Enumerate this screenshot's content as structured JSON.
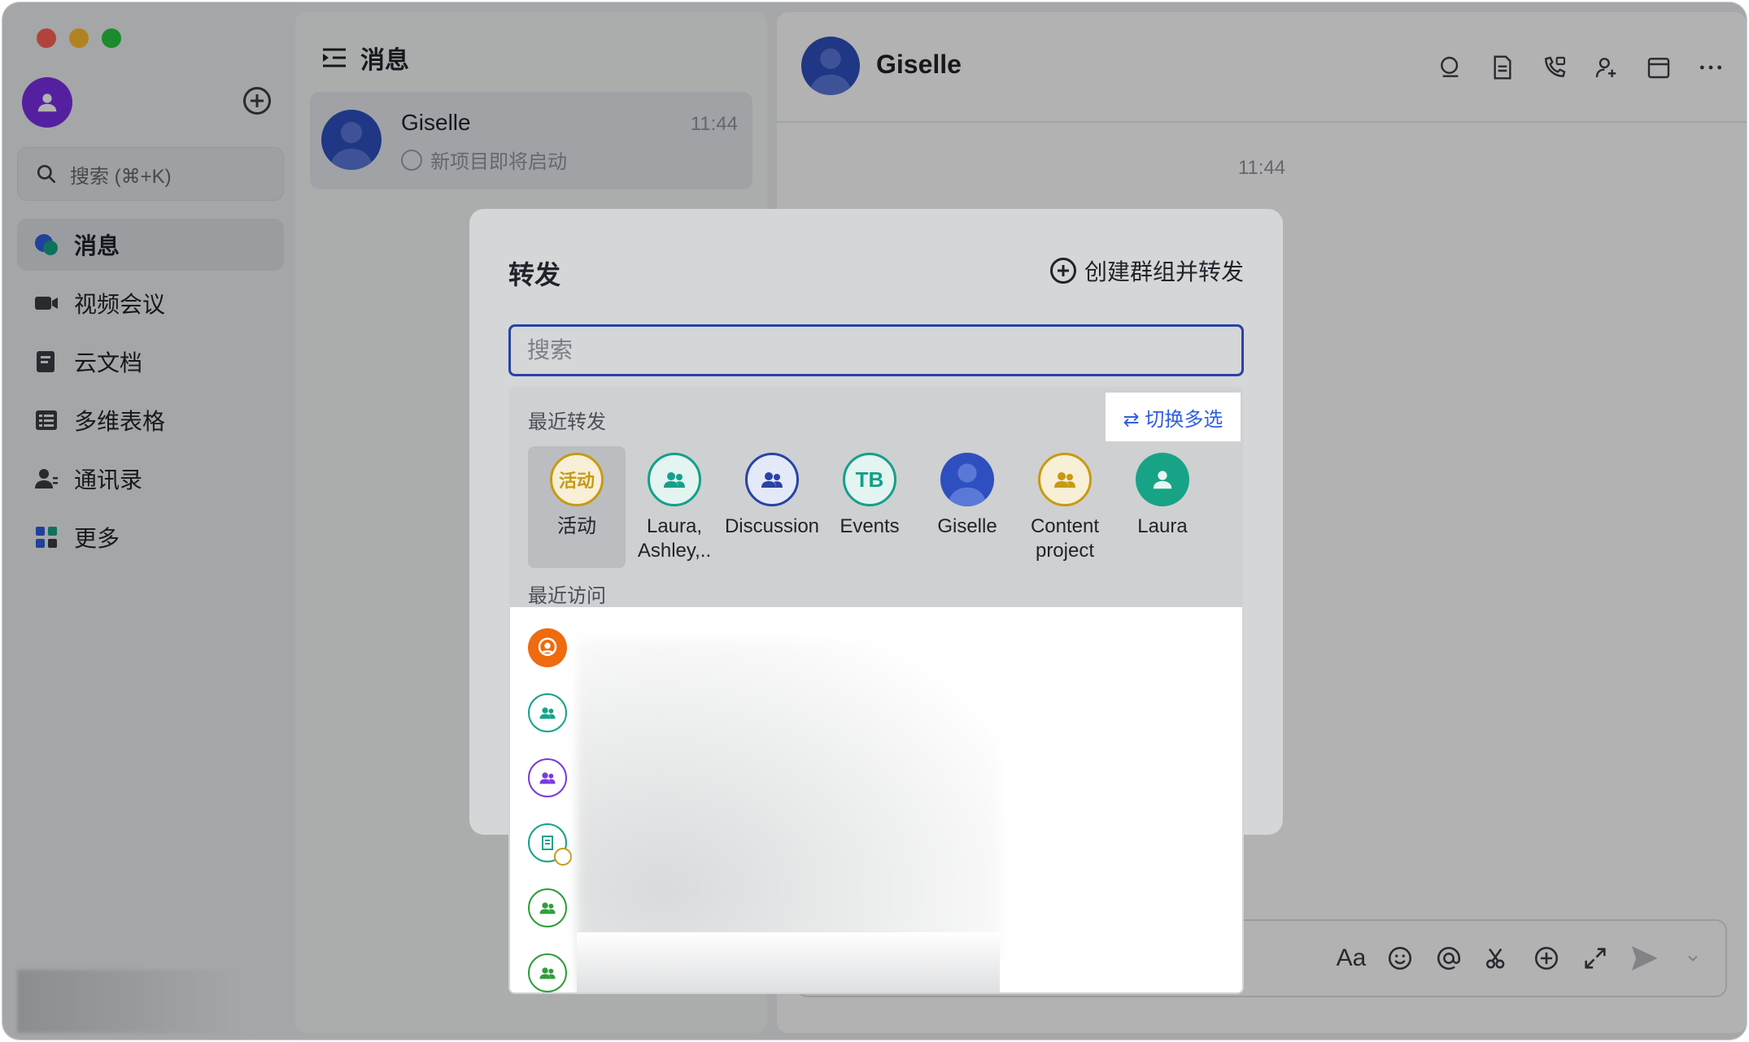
{
  "sidebar": {
    "search_placeholder": "搜索 (⌘+K)",
    "items": [
      {
        "label": "消息",
        "icon": "messages-icon"
      },
      {
        "label": "视频会议",
        "icon": "video-icon"
      },
      {
        "label": "云文档",
        "icon": "docs-icon"
      },
      {
        "label": "多维表格",
        "icon": "base-icon"
      },
      {
        "label": "通讯录",
        "icon": "contacts-icon"
      },
      {
        "label": "更多",
        "icon": "more-apps-icon"
      }
    ]
  },
  "chatlist": {
    "title": "消息",
    "chats": [
      {
        "name": "Giselle",
        "time": "11:44",
        "preview": "新项目即将启动"
      }
    ]
  },
  "chat": {
    "name": "Giselle",
    "message_time": "11:44",
    "composer_font_label": "Aa"
  },
  "dialog": {
    "title": "转发",
    "create_group_label": "创建群组并转发",
    "search_placeholder": "搜索",
    "recent_forward_label": "最近转发",
    "switch_multi_label": "⇄ 切换多选",
    "recent_visit_label": "最近访问",
    "recent": [
      {
        "name": "活动",
        "avatar_text": "活动",
        "color": "#c79a14",
        "style": "ring"
      },
      {
        "name": "Laura, Ashley,..",
        "avatar_text": "",
        "color": "#13a08a",
        "style": "ring"
      },
      {
        "name": "Discussion",
        "avatar_text": "",
        "color": "#2743a6",
        "style": "ring"
      },
      {
        "name": "Events",
        "avatar_text": "TB",
        "color": "#13a08a",
        "style": "ring"
      },
      {
        "name": "Giselle",
        "avatar_text": "",
        "color": "#2e4fbf",
        "style": "photo"
      },
      {
        "name": "Content project",
        "avatar_text": "",
        "color": "#c79a14",
        "style": "ring"
      },
      {
        "name": "Laura",
        "avatar_text": "",
        "color": "#17a386",
        "style": "solid"
      }
    ],
    "visits": [
      {
        "color": "#f06a0f",
        "style": "solid"
      },
      {
        "color": "#14a38a",
        "style": "ring"
      },
      {
        "color": "#7a3ae0",
        "style": "ring"
      },
      {
        "color": "#14a38a",
        "style": "ring-doc"
      },
      {
        "color": "#2e9e3a",
        "style": "ring"
      },
      {
        "color": "#2e9e3a",
        "style": "ring"
      }
    ]
  }
}
